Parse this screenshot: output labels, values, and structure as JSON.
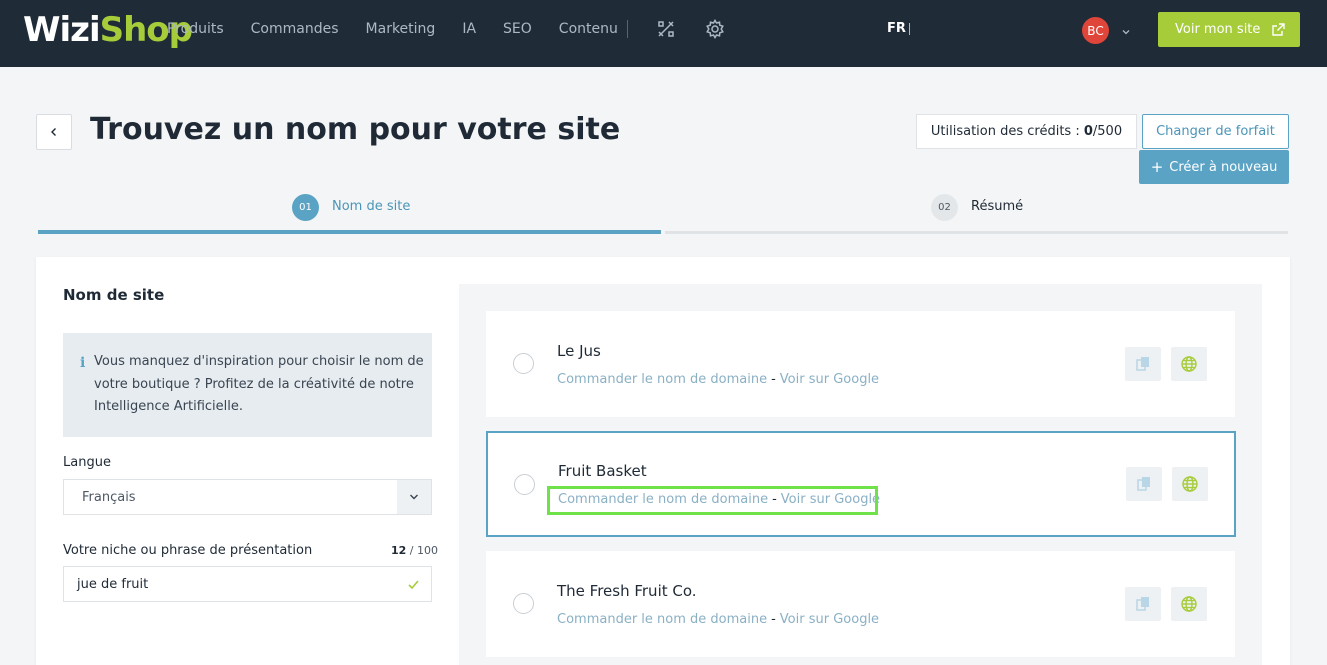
{
  "brand": {
    "logo_part1": "Wizi",
    "logo_part2": "Shop"
  },
  "nav": {
    "items": [
      "Produits",
      "Commandes",
      "Marketing",
      "IA",
      "SEO",
      "Contenu"
    ],
    "lang": "FR",
    "avatar": "BC",
    "view_site": "Voir mon site"
  },
  "header": {
    "title": "Trouvez un nom pour votre site",
    "credits_label": "Utilisation des crédits : ",
    "credits_used": "0",
    "credits_total": "/500",
    "change_plan": "Changer de forfait",
    "create_again": "Créer à nouveau"
  },
  "steps": [
    {
      "num": "01",
      "label": "Nom de site"
    },
    {
      "num": "02",
      "label": "Résumé"
    }
  ],
  "form": {
    "section_title": "Nom de site",
    "info_icon": "i",
    "info_text": "Vous manquez d'inspiration pour choisir le nom de votre boutique ? Profitez de la créativité de notre Intelligence Artificielle.",
    "language_label": "Langue",
    "language_value": "Français",
    "niche_label": "Votre niche ou phrase de présentation",
    "counter_current": "12",
    "counter_max": " / 100",
    "niche_value": "jue de fruit"
  },
  "suggestions": [
    {
      "name": "Le Jus",
      "order_link": "Commander le nom de domaine",
      "separator": "-",
      "google_link": "Voir sur Google"
    },
    {
      "name": "Fruit Basket",
      "order_link": "Commander le nom de domaine",
      "separator": "-",
      "google_link": "Voir sur Google"
    },
    {
      "name": "The Fresh Fruit Co.",
      "order_link": "Commander le nom de domaine",
      "separator": "-",
      "google_link": "Voir sur Google"
    }
  ],
  "colors": {
    "topbar": "#1f2c38",
    "accent_green": "#a6cc3a",
    "accent_blue": "#5aa3c4",
    "avatar": "#e0453a",
    "highlight": "#6fe24a"
  },
  "icons": {
    "tools": "tools-icon",
    "settings": "gear-icon",
    "external": "external-link-icon",
    "copy": "copy-icon",
    "globe": "globe-icon"
  }
}
